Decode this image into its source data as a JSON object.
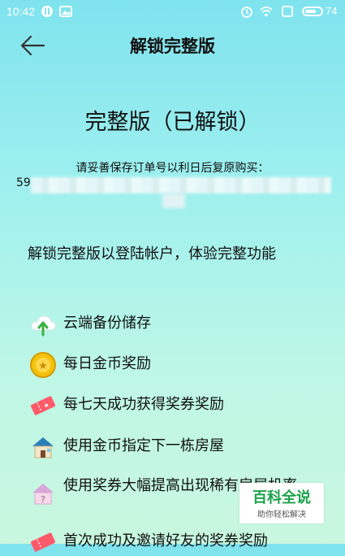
{
  "status_bar": {
    "time": "10:42",
    "battery": "74",
    "battery_level": 0.74
  },
  "header": {
    "title": "解锁完整版"
  },
  "main": {
    "headline": "完整版（已解锁）",
    "save_hint": "请妥善保存订单号以利日后复原购买：",
    "order_number_prefix": "59",
    "description": "解锁完整版以登陆帐户，体验完整功能"
  },
  "features": [
    {
      "label": "云端备份储存",
      "icon": "cloud-upload-icon"
    },
    {
      "label": "每日金币奖励",
      "icon": "gold-coin-icon"
    },
    {
      "label": "每七天成功获得奖券奖励",
      "icon": "ticket-icon"
    },
    {
      "label": "使用金币指定下一栋房屋",
      "icon": "house-icon"
    },
    {
      "label": "使用奖券大幅提高出现稀有房屋机率",
      "icon": "rare-house-icon"
    },
    {
      "label": "首次成功及邀请好友的奖券奖励",
      "icon": "ticket-icon"
    }
  ],
  "watermark": {
    "main": "百科全说",
    "sub": "助你轻松解决"
  }
}
